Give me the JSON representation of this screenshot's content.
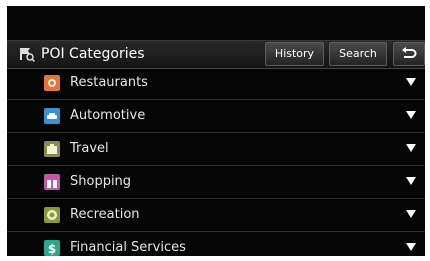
{
  "header": {
    "title": "POI Categories",
    "history_label": "History",
    "search_label": "Search",
    "back_glyph": "⮌"
  },
  "categories": [
    {
      "label": "Restaurants",
      "icon": "restaurant-icon",
      "color": "#e8763a"
    },
    {
      "label": "Automotive",
      "icon": "car-icon",
      "color": "#3a8fd6"
    },
    {
      "label": "Travel",
      "icon": "suitcase-icon",
      "color": "#8a8a4a"
    },
    {
      "label": "Shopping",
      "icon": "gift-icon",
      "color": "#c05aa6"
    },
    {
      "label": "Recreation",
      "icon": "recreation-icon",
      "color": "#8a9a3a"
    },
    {
      "label": "Financial Services",
      "icon": "dollar-icon",
      "color": "#2aa88a"
    }
  ]
}
